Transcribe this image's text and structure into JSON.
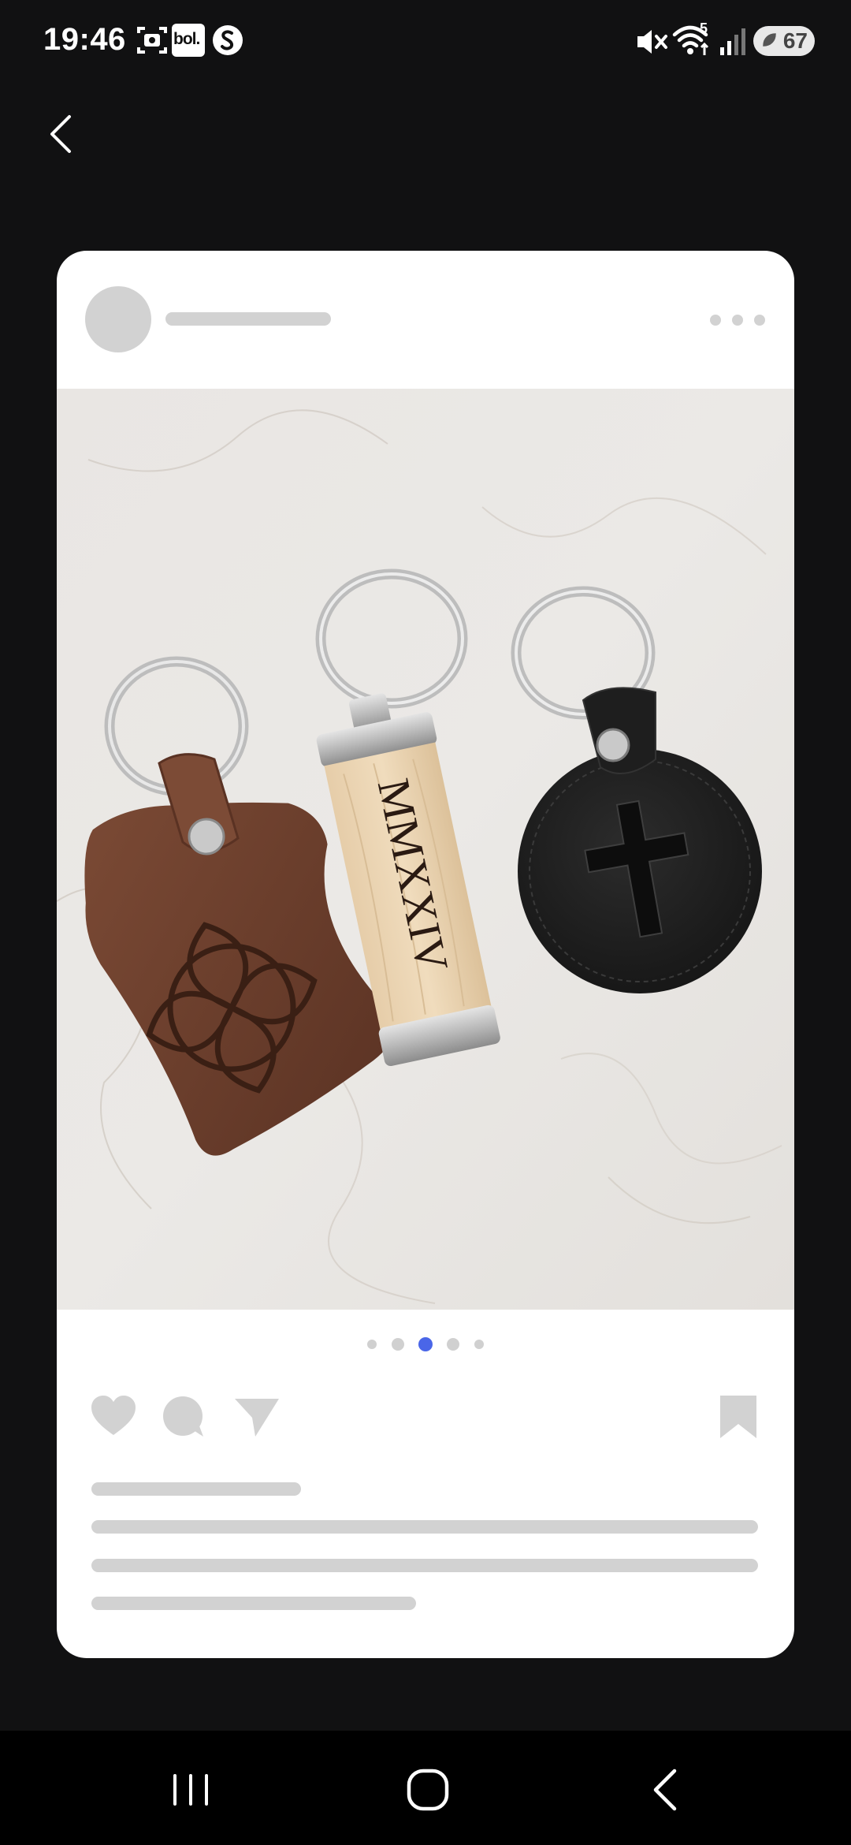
{
  "status_bar": {
    "time": "19:46",
    "left_icons": [
      "screenshot-icon",
      "bol-app-icon",
      "shazam-icon"
    ],
    "bol_label": "bol.",
    "right_icons": [
      "mute-icon",
      "wifi-icon",
      "signal-icon"
    ],
    "wifi_badge": "5",
    "battery_level": "67"
  },
  "photo": {
    "alt": "Three keychains on white marble: brown leather with Celtic knot, wooden bar engraved MMXXIV, black leather round with cross",
    "engraving": "MMXXIV"
  },
  "carousel": {
    "page_count": 5,
    "active_index": 2,
    "active_color": "#4a66e8",
    "inactive_color": "#d0d0d0"
  },
  "colors": {
    "background": "#111112",
    "card": "#ffffff",
    "placeholder": "#d2d2d2"
  }
}
